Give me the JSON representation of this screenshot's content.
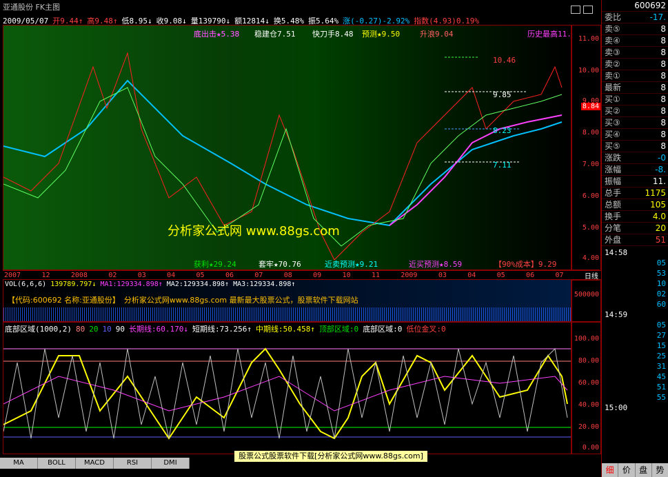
{
  "window": {
    "title": "亚通股份 FK主图"
  },
  "infobar": {
    "date": "2009/05/07",
    "open": "开9.44↑",
    "high": "高9.48↑",
    "low": "低8.95↓",
    "close": "收9.08↓",
    "volume": "量139790↓",
    "amount": "额12814↓",
    "turnover": "换5.48%",
    "amplitude": "振5.64%",
    "change": "涨(-0.27)-2.92%",
    "index": "指数(4.93)0.19%"
  },
  "overlay_labels": {
    "bottom_out": "底出击★5.38",
    "steady": "稳建仓7.51",
    "quick": "快刀手8.48",
    "forecast": "预测★9.50",
    "rise": "升浪9.04",
    "hist_high": "历史最高11.",
    "gain": "获利★29.24",
    "trap": "套牢★70.76",
    "near_sell": "近卖预测★9.21",
    "near_buy": "近买预测★8.59",
    "cost90": "【90%成本】9.29",
    "watermark": "分析家公式网 www.88gs.com",
    "price_markers": [
      "10.46",
      "9.85",
      "8.23",
      "7.11"
    ]
  },
  "price_axis": [
    "11.00",
    "10.00",
    "9.00",
    "8.00",
    "7.00",
    "6.00",
    "5.00",
    "4.00"
  ],
  "price_last": "8.84",
  "dates": [
    "2007",
    "12",
    "2008",
    "02",
    "03",
    "04",
    "05",
    "06",
    "07",
    "08",
    "09",
    "10",
    "11",
    "2009",
    "03",
    "04",
    "05",
    "06",
    "07",
    "日线"
  ],
  "volume": {
    "header": "VOL(6,6,6)",
    "val": "139789.797↓",
    "ma1": "MA1:129334.898↑",
    "ma2": "MA2:129334.898↑",
    "ma3": "MA3:129334.898↑",
    "axis": "500000",
    "banner": "【代码:600692 名称:亚通股份】",
    "banner2": "分析家公式网www.88gs.com 最新最大股票公式，股票软件下载网站"
  },
  "indicator": {
    "header": "底部区域(1000,2)",
    "p80": "80",
    "p20": "20",
    "p10": "10",
    "p90": "90",
    "long": "长期线:60.170↓",
    "short": "短期线:73.256↑",
    "mid": "中期线:50.458↑",
    "top": "顶部区域:0",
    "bottom": "底部区域:0",
    "golden": "低位金叉:0",
    "axis": [
      "100.00",
      "80.00",
      "60.00",
      "40.00",
      "20.00",
      "0.00"
    ]
  },
  "tabs": [
    "MA",
    "BOLL",
    "MACD",
    "RSI",
    "DMI"
  ],
  "footer_note": "股票公式股票软件下载[分析家公式网www.88gs.com]",
  "sidebar": {
    "code": "600692",
    "rows": [
      {
        "label": "委比",
        "val": "-17."
      },
      {
        "label": "卖⑤",
        "val": "8"
      },
      {
        "label": "卖④",
        "val": "8"
      },
      {
        "label": "卖③",
        "val": "8"
      },
      {
        "label": "卖②",
        "val": "8"
      },
      {
        "label": "卖①",
        "val": "8"
      },
      {
        "label": "最新",
        "val": "8"
      },
      {
        "label": "买①",
        "val": "8"
      },
      {
        "label": "买②",
        "val": "8"
      },
      {
        "label": "买③",
        "val": "8"
      },
      {
        "label": "买④",
        "val": "8"
      },
      {
        "label": "买⑤",
        "val": "8"
      },
      {
        "label": "涨跌",
        "val": "-0"
      },
      {
        "label": "涨幅",
        "val": "-8."
      },
      {
        "label": "振幅",
        "val": "11."
      },
      {
        "label": "总手",
        "val": "1175"
      },
      {
        "label": "总额",
        "val": "105"
      },
      {
        "label": "换手",
        "val": "4.0"
      },
      {
        "label": "分笔",
        "val": "20"
      },
      {
        "label": "外盘",
        "val": "51"
      }
    ],
    "ticks": [
      {
        "t": "14:58",
        "v": ""
      },
      {
        "t": "",
        "v": "05"
      },
      {
        "t": "",
        "v": "53"
      },
      {
        "t": "",
        "v": "10"
      },
      {
        "t": "",
        "v": "02"
      },
      {
        "t": "",
        "v": "60"
      },
      {
        "t": "14:59",
        "v": ""
      },
      {
        "t": "",
        "v": "05"
      },
      {
        "t": "",
        "v": "27"
      },
      {
        "t": "",
        "v": "15"
      },
      {
        "t": "",
        "v": "25"
      },
      {
        "t": "",
        "v": "31"
      },
      {
        "t": "",
        "v": "45"
      },
      {
        "t": "",
        "v": "51"
      },
      {
        "t": "",
        "v": "55"
      },
      {
        "t": "15:00",
        "v": ""
      }
    ],
    "bottom_tabs": [
      "细",
      "价",
      "盘",
      "势"
    ]
  }
}
